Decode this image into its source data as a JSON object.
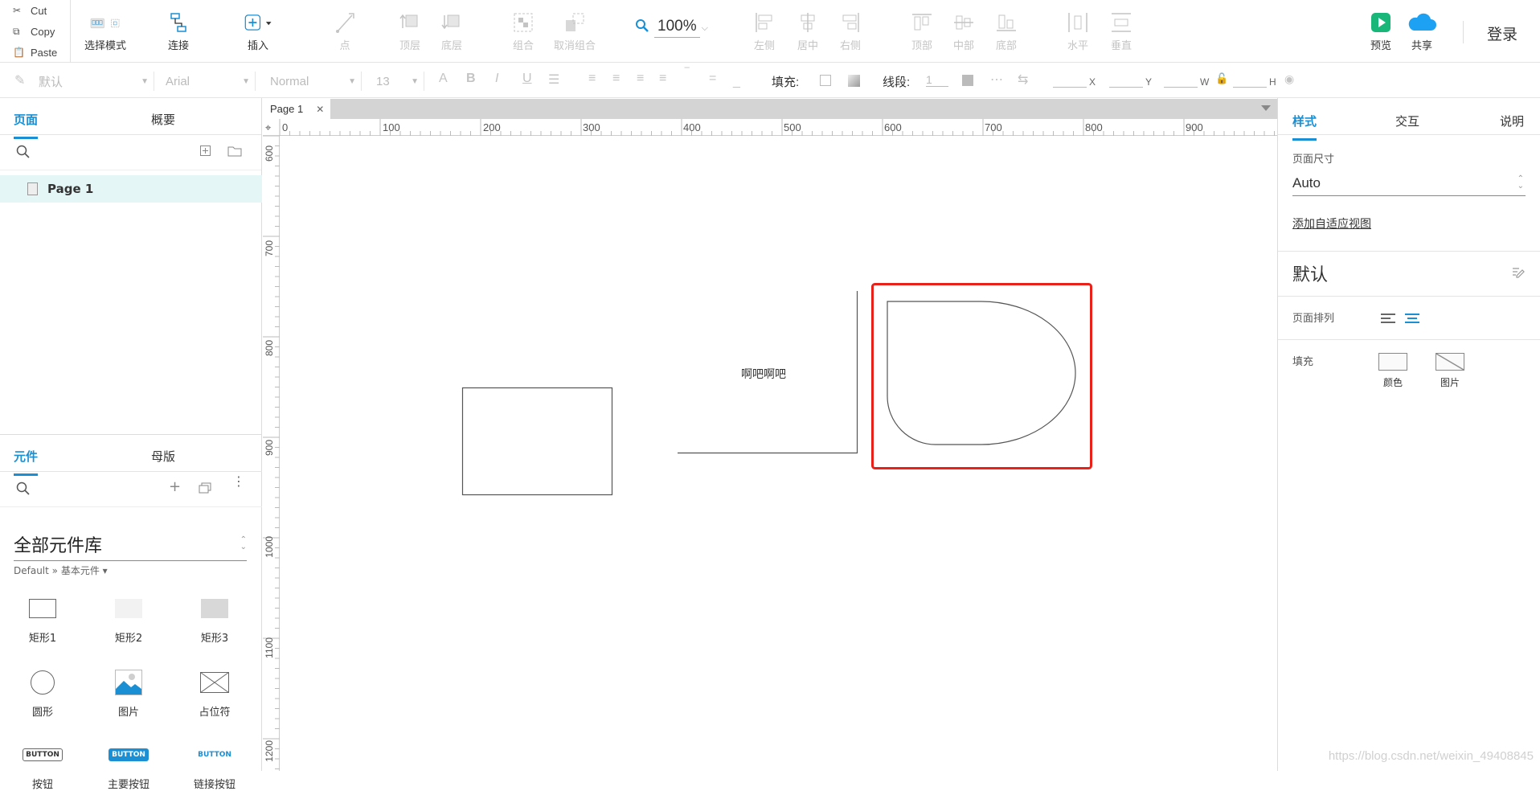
{
  "clipboard": {
    "cut": "Cut",
    "copy": "Copy",
    "paste": "Paste"
  },
  "toolbar": {
    "select_mode": "选择模式",
    "connect": "连接",
    "insert": "插入",
    "point": "点",
    "top_layer": "顶层",
    "bottom_layer": "底层",
    "group": "组合",
    "ungroup": "取消组合",
    "zoom": "100%",
    "align_left": "左侧",
    "align_center": "居中",
    "align_right": "右侧",
    "align_top": "顶部",
    "align_middle": "中部",
    "align_bottom": "底部",
    "distribute_h": "水平",
    "distribute_v": "垂直",
    "preview": "预览",
    "share": "共享",
    "login": "登录"
  },
  "format_bar": {
    "style": "默认",
    "font": "Arial",
    "weight": "Normal",
    "size": "13",
    "fill_label": "填充:",
    "line_label": "线段:",
    "line_value": "1",
    "x": "X",
    "y": "Y",
    "w": "W",
    "h": "H"
  },
  "left_panel": {
    "tabs": [
      "页面",
      "概要"
    ],
    "page_item": "Page 1",
    "lib_tabs": [
      "元件",
      "母版"
    ],
    "library_name": "全部元件库",
    "library_sub": "Default » 基本元件 ▾",
    "widgets": [
      "矩形1",
      "矩形2",
      "矩形3",
      "圆形",
      "图片",
      "占位符",
      "按钮",
      "主要按钮",
      "链接按钮"
    ],
    "button_texts": {
      "plain": "BUTTON",
      "primary": "BUTTON",
      "link": "BUTTON"
    }
  },
  "canvas": {
    "tab": "Page 1",
    "ruler_h": [
      "0",
      "100",
      "200",
      "300",
      "400",
      "500",
      "600",
      "700",
      "800",
      "900"
    ],
    "ruler_v": [
      "600",
      "700",
      "800",
      "900",
      "1000",
      "1100",
      "1200"
    ],
    "text": "啊吧啊吧",
    "watermark": "https://blog.csdn.net/weixin_49408845"
  },
  "right_panel": {
    "tabs": [
      "样式",
      "交互",
      "说明"
    ],
    "page_size_label": "页面尺寸",
    "page_size_value": "Auto",
    "adaptive_link": "添加自适应视图",
    "default_heading": "默认",
    "page_align_label": "页面排列",
    "fill_label": "填充",
    "fill_color": "颜色",
    "fill_image": "图片"
  },
  "colors": {
    "accent": "#1a8fd4",
    "selection": "#e8221b",
    "preview": "#19b67a",
    "share": "#1da1f2"
  }
}
